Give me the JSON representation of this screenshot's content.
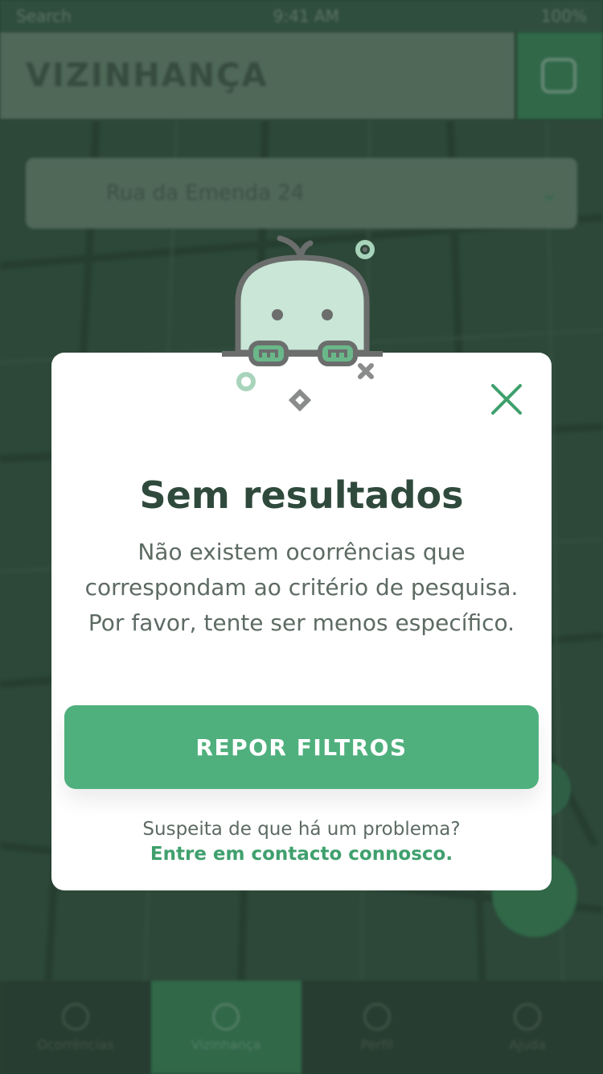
{
  "background": {
    "status_bar": {
      "carrier": "Search",
      "time": "9:41 AM",
      "battery": "100%"
    },
    "header": {
      "title": "VIZINHANÇA"
    },
    "address_field": {
      "value": "Rua da Emenda 24"
    },
    "tabs": [
      {
        "label": "Ocorrências"
      },
      {
        "label": "Vizinhança"
      },
      {
        "label": "Perfil"
      },
      {
        "label": "Ajuda"
      }
    ]
  },
  "modal": {
    "title": "Sem resultados",
    "body_lines": [
      "Não existem ocorrências que",
      "correspondam ao critério de pesquisa.",
      "Por favor, tente ser menos específico."
    ],
    "primary_button": "REPOR FILTROS",
    "help_question": "Suspeita de que há um problema?",
    "help_link": "Entre em contacto connosco."
  },
  "colors": {
    "accent_green": "#4fb07d",
    "title_dark": "#2f4a3c",
    "body_gray": "#5d6b63",
    "mascot_fill": "#c9e6d6",
    "mascot_stroke": "#6b6e6d"
  },
  "icons": {
    "close": "close-icon",
    "mascot": "mascot-illustration"
  }
}
